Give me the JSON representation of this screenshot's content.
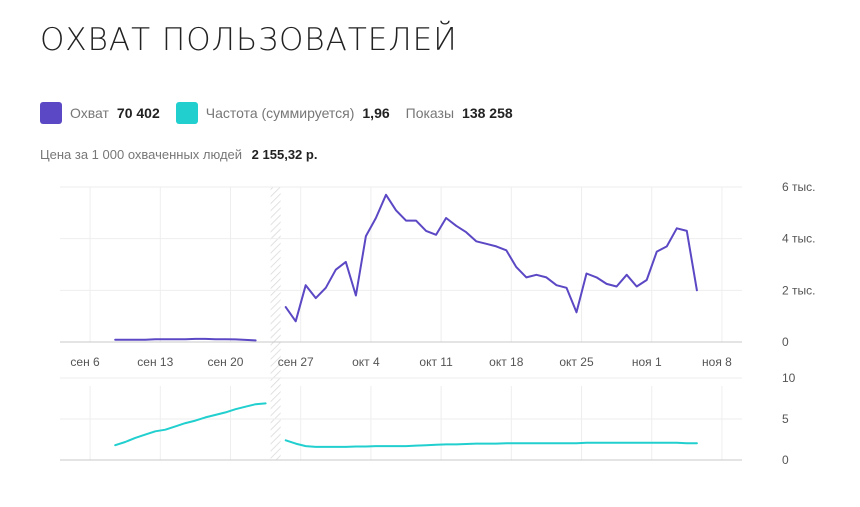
{
  "title": "ОХВАТ ПОЛЬЗОВАТЕЛЕЙ",
  "legend": {
    "reach": {
      "label": "Охват",
      "value": "70 402",
      "color": "#5b48c4"
    },
    "frequency": {
      "label": "Частота (суммируется)",
      "value": "1,96",
      "color": "#22cfcf"
    },
    "impressions": {
      "label": "Показы",
      "value": "138 258"
    }
  },
  "price": {
    "label": "Цена за 1 000 охваченных людей",
    "value": "2 155,32 р."
  },
  "chart_data": [
    {
      "type": "line",
      "series": [
        {
          "name": "Охват",
          "color": "#5b48c4",
          "segments": [
            [
              [
                9,
                90
              ],
              [
                10,
                85
              ],
              [
                11,
                85
              ],
              [
                12,
                85
              ],
              [
                13,
                110
              ],
              [
                14,
                110
              ],
              [
                15,
                110
              ],
              [
                16,
                110
              ],
              [
                17,
                120
              ],
              [
                18,
                120
              ],
              [
                19,
                110
              ],
              [
                20,
                110
              ],
              [
                21,
                100
              ],
              [
                22,
                80
              ],
              [
                23,
                60
              ]
            ],
            [
              [
                26,
                1350
              ],
              [
                27,
                800
              ],
              [
                28,
                2200
              ],
              [
                29,
                1700
              ],
              [
                30,
                2100
              ],
              [
                31,
                2800
              ],
              [
                32,
                3100
              ],
              [
                33,
                1800
              ],
              [
                34,
                4100
              ],
              [
                35,
                4800
              ],
              [
                36,
                5700
              ],
              [
                37,
                5100
              ],
              [
                38,
                4700
              ],
              [
                39,
                4700
              ],
              [
                40,
                4300
              ],
              [
                41,
                4150
              ],
              [
                42,
                4800
              ],
              [
                43,
                4500
              ],
              [
                44,
                4250
              ],
              [
                45,
                3900
              ],
              [
                46,
                3800
              ],
              [
                47,
                3700
              ],
              [
                48,
                3550
              ],
              [
                49,
                2900
              ],
              [
                50,
                2500
              ],
              [
                51,
                2600
              ],
              [
                52,
                2500
              ],
              [
                53,
                2200
              ],
              [
                54,
                2100
              ],
              [
                55,
                1150
              ],
              [
                56,
                2650
              ],
              [
                57,
                2500
              ],
              [
                58,
                2250
              ],
              [
                59,
                2150
              ],
              [
                60,
                2600
              ],
              [
                61,
                2150
              ],
              [
                62,
                2400
              ],
              [
                63,
                3500
              ],
              [
                64,
                3700
              ],
              [
                65,
                4400
              ],
              [
                66,
                4300
              ],
              [
                67,
                2000
              ]
            ]
          ]
        }
      ],
      "y_ticks": [
        "6 тыс.",
        "4 тыс.",
        "2 тыс.",
        "0"
      ],
      "y_values": [
        6000,
        4000,
        2000,
        0
      ],
      "ylim": [
        0,
        6000
      ],
      "x_ticks": [
        {
          "x": 6,
          "label": "сен 6"
        },
        {
          "x": 13,
          "label": "сен 13"
        },
        {
          "x": 20,
          "label": "сен 20"
        },
        {
          "x": 27,
          "label": "сен 27"
        },
        {
          "x": 34,
          "label": "окт 4"
        },
        {
          "x": 41,
          "label": "окт 11"
        },
        {
          "x": 48,
          "label": "окт 18"
        },
        {
          "x": 55,
          "label": "окт 25"
        },
        {
          "x": 62,
          "label": "ноя 1"
        },
        {
          "x": 69,
          "label": "ноя 8"
        }
      ],
      "grid": true
    },
    {
      "type": "line",
      "series": [
        {
          "name": "Частота (суммируется)",
          "color": "#22cfcf",
          "segments": [
            [
              [
                9,
                1.8
              ],
              [
                10,
                2.2
              ],
              [
                11,
                2.7
              ],
              [
                12,
                3.1
              ],
              [
                13,
                3.5
              ],
              [
                14,
                3.7
              ],
              [
                15,
                4.1
              ],
              [
                16,
                4.5
              ],
              [
                17,
                4.8
              ],
              [
                18,
                5.2
              ],
              [
                19,
                5.5
              ],
              [
                20,
                5.8
              ],
              [
                21,
                6.2
              ],
              [
                22,
                6.5
              ],
              [
                23,
                6.8
              ],
              [
                24,
                6.9
              ]
            ],
            [
              [
                26,
                2.4
              ],
              [
                27,
                2.0
              ],
              [
                28,
                1.7
              ],
              [
                29,
                1.6
              ],
              [
                30,
                1.6
              ],
              [
                31,
                1.6
              ],
              [
                32,
                1.6
              ],
              [
                33,
                1.65
              ],
              [
                34,
                1.65
              ],
              [
                35,
                1.7
              ],
              [
                36,
                1.7
              ],
              [
                37,
                1.7
              ],
              [
                38,
                1.7
              ],
              [
                39,
                1.75
              ],
              [
                40,
                1.8
              ],
              [
                41,
                1.85
              ],
              [
                42,
                1.9
              ],
              [
                43,
                1.9
              ],
              [
                44,
                1.95
              ],
              [
                45,
                2.0
              ],
              [
                46,
                2.0
              ],
              [
                47,
                2.0
              ],
              [
                48,
                2.05
              ],
              [
                49,
                2.05
              ],
              [
                50,
                2.05
              ],
              [
                51,
                2.05
              ],
              [
                52,
                2.05
              ],
              [
                53,
                2.05
              ],
              [
                54,
                2.05
              ],
              [
                55,
                2.05
              ],
              [
                56,
                2.1
              ],
              [
                57,
                2.1
              ],
              [
                58,
                2.1
              ],
              [
                59,
                2.1
              ],
              [
                60,
                2.1
              ],
              [
                61,
                2.1
              ],
              [
                62,
                2.1
              ],
              [
                63,
                2.1
              ],
              [
                64,
                2.1
              ],
              [
                65,
                2.1
              ],
              [
                66,
                2.05
              ],
              [
                67,
                2.05
              ]
            ]
          ]
        }
      ],
      "y_ticks": [
        "10",
        "5",
        "0"
      ],
      "y_values": [
        10,
        5,
        0
      ],
      "ylim": [
        0,
        10
      ],
      "grid": true
    }
  ],
  "gap": {
    "from": 24.5,
    "to": 25.5
  }
}
